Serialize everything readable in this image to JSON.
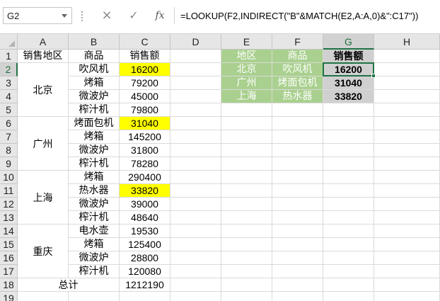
{
  "name_box": "G2",
  "formula_icons": {
    "cancel": "cancel-icon",
    "enter": "enter-check-icon",
    "fx": "function-icon"
  },
  "formula_glyphs": {
    "cancel": "×",
    "enter": "✓",
    "fx": "fx"
  },
  "formula": "=LOOKUP(F2,INDIRECT(\"B\"&MATCH(E2,A:A,0)&\":C17\"))",
  "columns": [
    "A",
    "B",
    "C",
    "D",
    "E",
    "F",
    "G",
    "H"
  ],
  "rows": [
    "1",
    "2",
    "3",
    "4",
    "5",
    "6",
    "7",
    "8",
    "9",
    "10",
    "11",
    "12",
    "13",
    "14",
    "15",
    "16",
    "17",
    "18",
    "19"
  ],
  "selected": {
    "column": "G",
    "row": "2"
  },
  "headers": {
    "region": "销售地区",
    "product": "商品",
    "sales": "销售额"
  },
  "regions": [
    "北京",
    "广州",
    "上海",
    "重庆"
  ],
  "data_rows": [
    {
      "product": "吹风机",
      "sales": "16200",
      "highlight": true
    },
    {
      "product": "烤箱",
      "sales": "79200"
    },
    {
      "product": "微波炉",
      "sales": "45000"
    },
    {
      "product": "榨汁机",
      "sales": "79800"
    },
    {
      "product": "烤面包机",
      "sales": "31040",
      "highlight": true
    },
    {
      "product": "烤箱",
      "sales": "145200"
    },
    {
      "product": "微波炉",
      "sales": "31800"
    },
    {
      "product": "榨汁机",
      "sales": "78280"
    },
    {
      "product": "烤箱",
      "sales": "290400"
    },
    {
      "product": "热水器",
      "sales": "33820",
      "highlight": true
    },
    {
      "product": "微波炉",
      "sales": "39000"
    },
    {
      "product": "榨汁机",
      "sales": "48640"
    },
    {
      "product": "电水壶",
      "sales": "19530"
    },
    {
      "product": "烤箱",
      "sales": "125400"
    },
    {
      "product": "微波炉",
      "sales": "28800"
    },
    {
      "product": "榨汁机",
      "sales": "120080"
    }
  ],
  "total": {
    "label": "总计",
    "value": "1212190"
  },
  "lookup": {
    "headers": {
      "region": "地区",
      "product": "商品",
      "sales": "销售额"
    },
    "rows": [
      {
        "region": "北京",
        "product": "吹风机",
        "sales": "16200"
      },
      {
        "region": "广州",
        "product": "烤面包机",
        "sales": "31040"
      },
      {
        "region": "上海",
        "product": "热水器",
        "sales": "33820"
      }
    ]
  },
  "colors": {
    "highlight": "#ffff00",
    "lookup_header": "#a9d08e",
    "result": "#d0d0d0",
    "accent": "#217346"
  }
}
